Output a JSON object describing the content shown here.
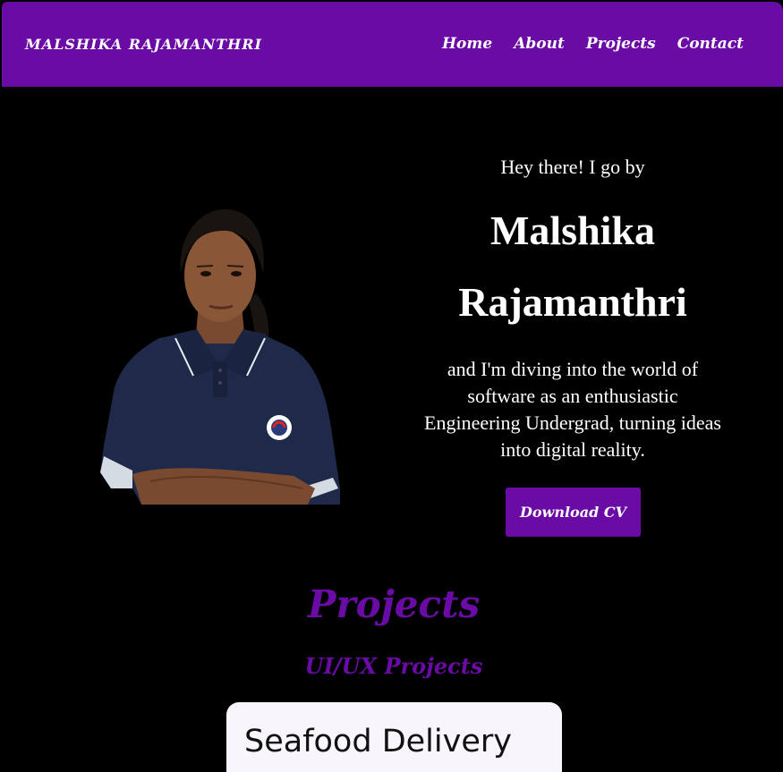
{
  "nav": {
    "brand": "MALSHIKA RAJAMANTHRI",
    "links": [
      "Home",
      "About",
      "Projects",
      "Contact"
    ]
  },
  "hero": {
    "greeting": "Hey there! I go by",
    "name_first": "Malshika",
    "name_last": "Rajamanthri",
    "tagline": "and I'm diving into the world of software as an enthusiastic Engineering Undergrad, turning ideas into digital reality.",
    "cv_button": "Download CV"
  },
  "projects": {
    "title": "Projects",
    "subtitle": "UI/UX Projects",
    "cards": [
      {
        "title": "Seafood Delivery"
      }
    ]
  },
  "colors": {
    "accent": "#6a0ba5",
    "background": "#000000",
    "card": "#f9f5fc"
  }
}
